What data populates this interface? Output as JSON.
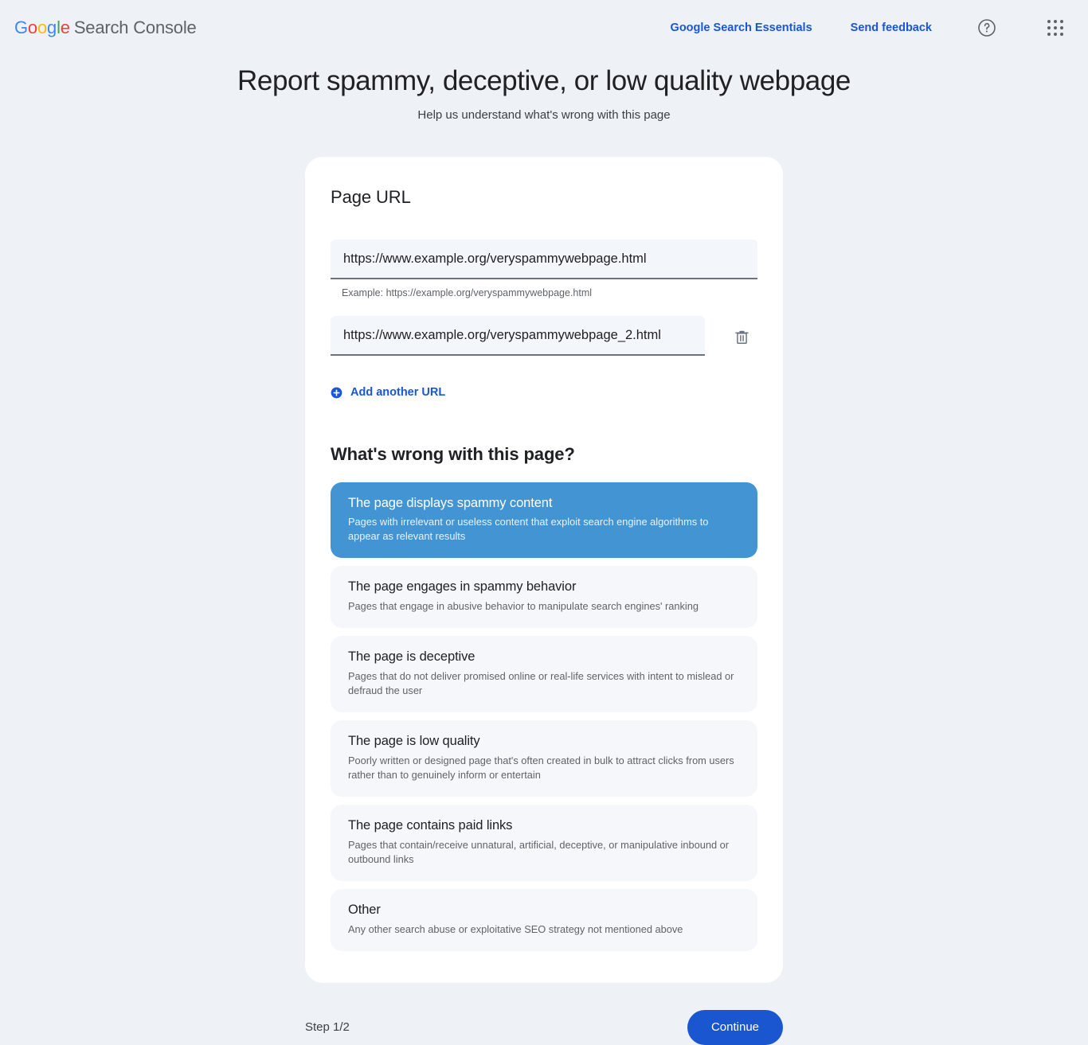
{
  "header": {
    "brand": {
      "g1": "G",
      "o1": "o",
      "o2": "o",
      "g2": "g",
      "l": "l",
      "e": "e",
      "product": "Search Console"
    },
    "links": [
      {
        "label": "Google Search Essentials",
        "name": "google-search-essentials-link"
      },
      {
        "label": "Send feedback",
        "name": "send-feedback-link"
      }
    ],
    "help_icon": "help-circle-icon",
    "apps_icon": "apps-grid-icon"
  },
  "page": {
    "title": "Report spammy, deceptive, or low quality webpage",
    "subtitle": "Help us understand what's wrong with this page"
  },
  "form": {
    "url_section_title": "Page URL",
    "urls": [
      {
        "value": "https://www.example.org/veryspammywebpage.html",
        "placeholder": "https://example.org/veryspammywebpage.html",
        "helper": "Example: https://example.org/veryspammywebpage.html"
      },
      {
        "value": "https://www.example.org/veryspammywebpage_2.html",
        "placeholder": "https://example.org/veryspammywebpage.html",
        "delete_icon": "trash-icon"
      }
    ],
    "add_url_label": "Add another URL",
    "add_url_icon": "plus-circle-icon"
  },
  "question": {
    "title": "What's wrong with this page?",
    "options": [
      {
        "title": "The page displays spammy content",
        "desc": "Pages with irrelevant or useless content that exploit search engine algorithms to appear as relevant results",
        "selected": true
      },
      {
        "title": "The page engages in spammy behavior",
        "desc": "Pages that engage in abusive behavior to manipulate search engines' ranking",
        "selected": false
      },
      {
        "title": "The page is deceptive",
        "desc": "Pages that do not deliver promised online or real-life services with intent to mislead or defraud the user",
        "selected": false
      },
      {
        "title": "The page is low quality",
        "desc": "Poorly written or designed page that's often created in bulk to attract clicks from users rather than to genuinely inform or entertain",
        "selected": false
      },
      {
        "title": "The page contains paid links",
        "desc": "Pages that contain/receive unnatural, artificial, deceptive, or manipulative inbound or outbound links",
        "selected": false
      },
      {
        "title": "Other",
        "desc": "Any other search abuse or exploitative SEO strategy not mentioned above",
        "selected": false
      }
    ]
  },
  "footer": {
    "step": "Step 1/2",
    "continue_label": "Continue"
  },
  "colors": {
    "page_bg": "#eef1f6",
    "card_bg": "#ffffff",
    "link_blue": "#1a56d8",
    "selected_option": "#4294d2",
    "continue_button": "#1a56d0",
    "option_bg": "#f5f7fb",
    "input_bg": "#f3f6fb"
  }
}
